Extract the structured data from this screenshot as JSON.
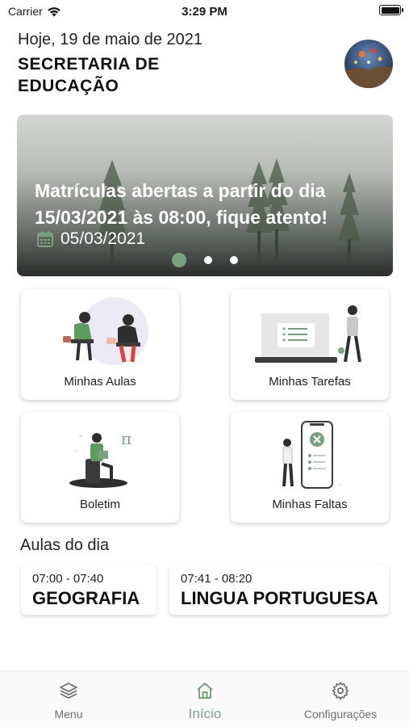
{
  "status_bar": {
    "carrier": "Carrier",
    "time": "3:29 PM"
  },
  "header": {
    "date": "Hoje, 19 de maio de 2021",
    "title": "SECRETARIA DE EDUCAÇÃO"
  },
  "banner": {
    "text": "Matrículas abertas a partir do dia 15/03/2021 às 08:00, fique atento!",
    "date": "05/03/2021",
    "dots_total": 3,
    "active_dot": 1
  },
  "cards": [
    {
      "label": "Minhas Aulas",
      "icon": "students-illustration"
    },
    {
      "label": "Minhas Tarefas",
      "icon": "laptop-tasks-illustration"
    },
    {
      "label": "Boletim",
      "icon": "reading-pi-illustration"
    },
    {
      "label": "Minhas Faltas",
      "icon": "phone-check-illustration"
    }
  ],
  "aulas": {
    "title": "Aulas do dia",
    "items": [
      {
        "time": "07:00 - 07:40",
        "subject": "GEOGRAFIA"
      },
      {
        "time": "07:41 - 08:20",
        "subject": "LINGUA PORTUGUESA"
      }
    ]
  },
  "tabbar": {
    "items": [
      {
        "label": "Menu",
        "icon": "layers-icon"
      },
      {
        "label": "Início",
        "icon": "home-icon",
        "active": true
      },
      {
        "label": "Configurações",
        "icon": "gear-icon"
      }
    ]
  },
  "colors": {
    "accent": "#7aa17f",
    "inactive": "#6e6e6e"
  }
}
